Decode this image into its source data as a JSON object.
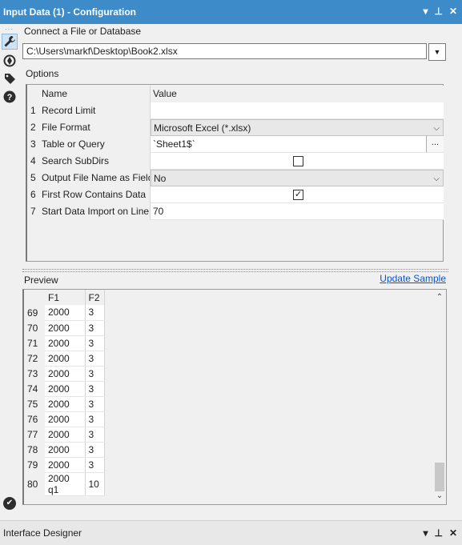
{
  "window": {
    "title": "Input Data (1) - Configuration",
    "controls": [
      "▾",
      "⊥",
      "✕"
    ]
  },
  "sidebar": {
    "icons": [
      "wrench-icon",
      "target-icon",
      "tag-icon",
      "help-icon"
    ]
  },
  "connect": {
    "label": "Connect a File or Database",
    "path": "C:\\Users\\markf\\Desktop\\Book2.xlsx"
  },
  "options": {
    "label": "Options",
    "header_name": "Name",
    "header_value": "Value",
    "rows": [
      {
        "num": "1",
        "name": "Record Limit",
        "value": ""
      },
      {
        "num": "2",
        "name": "File Format",
        "value": "Microsoft Excel (*.xlsx)"
      },
      {
        "num": "3",
        "name": "Table or Query",
        "value": "`Sheet1$`",
        "button": "..."
      },
      {
        "num": "4",
        "name": "Search SubDirs",
        "value": ""
      },
      {
        "num": "5",
        "name": "Output File Name as Field",
        "value": "No"
      },
      {
        "num": "6",
        "name": "First Row Contains Data",
        "value": "✓"
      },
      {
        "num": "7",
        "name": "Start Data Import on Line",
        "value": "70"
      }
    ]
  },
  "preview": {
    "label": "Preview",
    "update_link": "Update Sample",
    "columns": [
      "F1",
      "F2"
    ],
    "rows": [
      {
        "rn": "69",
        "f1": "2000",
        "f2": "3"
      },
      {
        "rn": "70",
        "f1": "2000",
        "f2": "3"
      },
      {
        "rn": "71",
        "f1": "2000",
        "f2": "3"
      },
      {
        "rn": "72",
        "f1": "2000",
        "f2": "3"
      },
      {
        "rn": "73",
        "f1": "2000",
        "f2": "3"
      },
      {
        "rn": "74",
        "f1": "2000",
        "f2": "3"
      },
      {
        "rn": "75",
        "f1": "2000",
        "f2": "3"
      },
      {
        "rn": "76",
        "f1": "2000",
        "f2": "3"
      },
      {
        "rn": "77",
        "f1": "2000",
        "f2": "3"
      },
      {
        "rn": "78",
        "f1": "2000",
        "f2": "3"
      },
      {
        "rn": "79",
        "f1": "2000",
        "f2": "3"
      },
      {
        "rn": "80",
        "f1": "2000 q1",
        "f2": "10"
      }
    ]
  },
  "bottom": {
    "title": "Interface Designer",
    "controls": [
      "▾",
      "⊥",
      "✕"
    ]
  },
  "colors": {
    "titlebar": "#3d8bc9",
    "link": "#0b54c8"
  }
}
